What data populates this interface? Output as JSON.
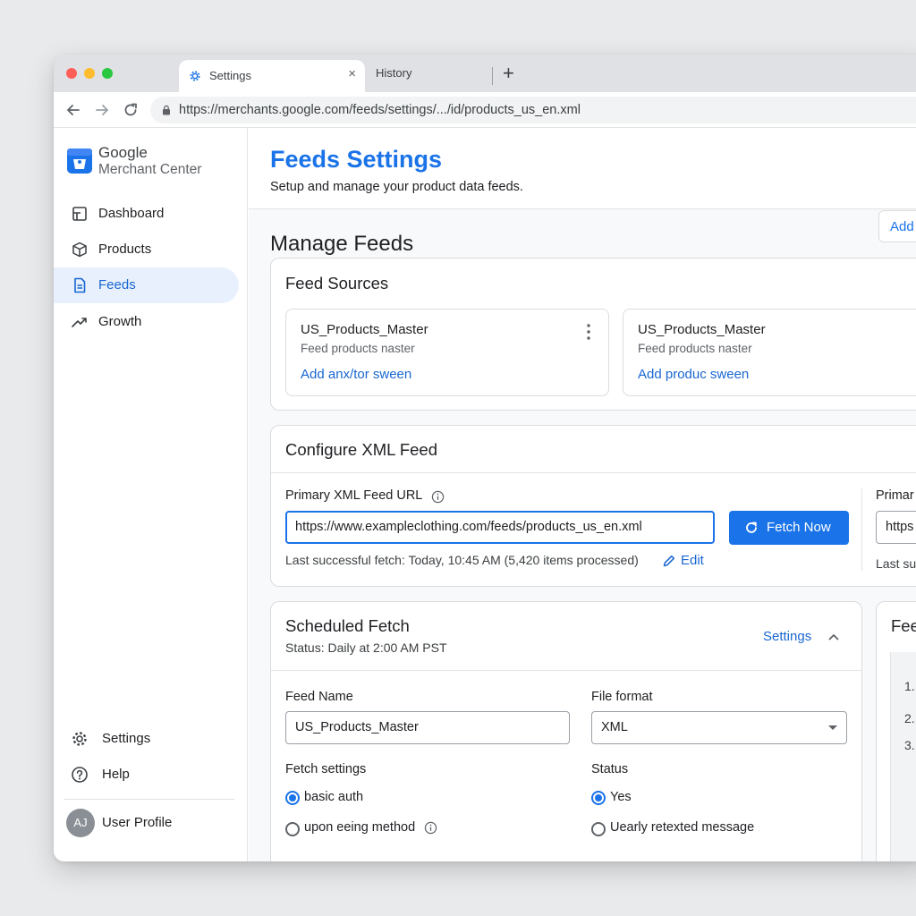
{
  "browser": {
    "active_tab": {
      "title": "Settings",
      "icon": "gear-icon",
      "close_glyph": "×"
    },
    "inactive_tab": {
      "title": "History"
    },
    "new_tab_glyph": "+",
    "url": "https://merchants.google.com/feeds/settings/.../id/products_us_en.xml"
  },
  "sidebar": {
    "brand_line1": "Google",
    "brand_line2": "Merchant Center",
    "items": [
      {
        "label": "Dashboard",
        "icon": "dashboard-icon"
      },
      {
        "label": "Products",
        "icon": "box-icon"
      },
      {
        "label": "Feeds",
        "icon": "document-icon",
        "active": true
      },
      {
        "label": "Growth",
        "icon": "trending-up-icon"
      }
    ],
    "bottom_items": [
      {
        "label": "Settings",
        "icon": "gear-icon"
      },
      {
        "label": "Help",
        "icon": "help-icon"
      }
    ],
    "profile": {
      "initials": "AJ",
      "label": "User Profile"
    }
  },
  "header": {
    "title": "Feeds Settings",
    "subtitle": "Setup and manage your product data feeds."
  },
  "manage": {
    "title": "Manage Feeds",
    "add_label": "Add"
  },
  "feed_sources": {
    "title": "Feed Sources",
    "cards": [
      {
        "name": "US_Products_Master",
        "description": "Feed products naster",
        "link": "Add anx/tor sween"
      },
      {
        "name": "US_Products_Master",
        "description": "Feed products naster",
        "link": "Add produc sween"
      }
    ]
  },
  "configure": {
    "title": "Configure XML Feed",
    "url_label": "Primary XML Feed URL",
    "url_value": "https://www.exampleclothing.com/feeds/products_us_en.xml",
    "fetch_button": "Fetch Now",
    "last_fetch": "Last successful fetch: Today, 10:45 AM (5,420 items processed)",
    "edit_label": "Edit",
    "side_label": "Primar",
    "side_value": "https",
    "side_last": "Last su"
  },
  "scheduled": {
    "title": "Scheduled Fetch",
    "status": "Status: Daily at 2:00 AM PST",
    "settings_link": "Settings",
    "feed_name_label": "Feed Name",
    "feed_name_value": "US_Products_Master",
    "file_format_label": "File format",
    "file_format_value": "XML",
    "fetch_settings_label": "Fetch settings",
    "fetch_options": [
      {
        "label": "basic auth",
        "selected": true
      },
      {
        "label": "upon eeing method",
        "selected": false
      }
    ],
    "status_label": "Status",
    "status_options": [
      {
        "label": "Yes",
        "selected": true
      },
      {
        "label": "Uearly retexted message",
        "selected": false
      }
    ]
  },
  "side_panel": {
    "title": "Fee",
    "list": [
      "1.",
      "2.",
      "3."
    ]
  },
  "colors": {
    "accent": "#1a73e8",
    "active_nav_bg": "#e8f0fe",
    "traffic_red": "#ff5f57",
    "traffic_yellow": "#febc2e",
    "traffic_green": "#28c840"
  }
}
